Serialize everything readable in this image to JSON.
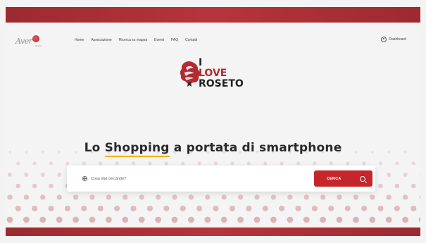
{
  "header": {
    "logo_text": "Aver",
    "logo_sub": "Roseto",
    "nav": [
      {
        "label": "Home"
      },
      {
        "label": "Associazione"
      },
      {
        "label": "Ricerca su mappa"
      },
      {
        "label": "Eventi"
      },
      {
        "label": "FAQ"
      },
      {
        "label": "Contatti"
      }
    ],
    "dashboard_label": "Dashboard"
  },
  "brand": {
    "line1": "I",
    "line2": "LOVE",
    "line3": "ROSETO"
  },
  "hero": {
    "headline_pre": "Lo ",
    "headline_highlight": "Shopping",
    "headline_post": " a portata di smartphone"
  },
  "search": {
    "placeholder": "Cosa stai cercando?",
    "button_label": "CERCA"
  },
  "colors": {
    "brand_red": "#c5262b",
    "bar_red": "#b7343b",
    "highlight_yellow": "#f0b400"
  }
}
